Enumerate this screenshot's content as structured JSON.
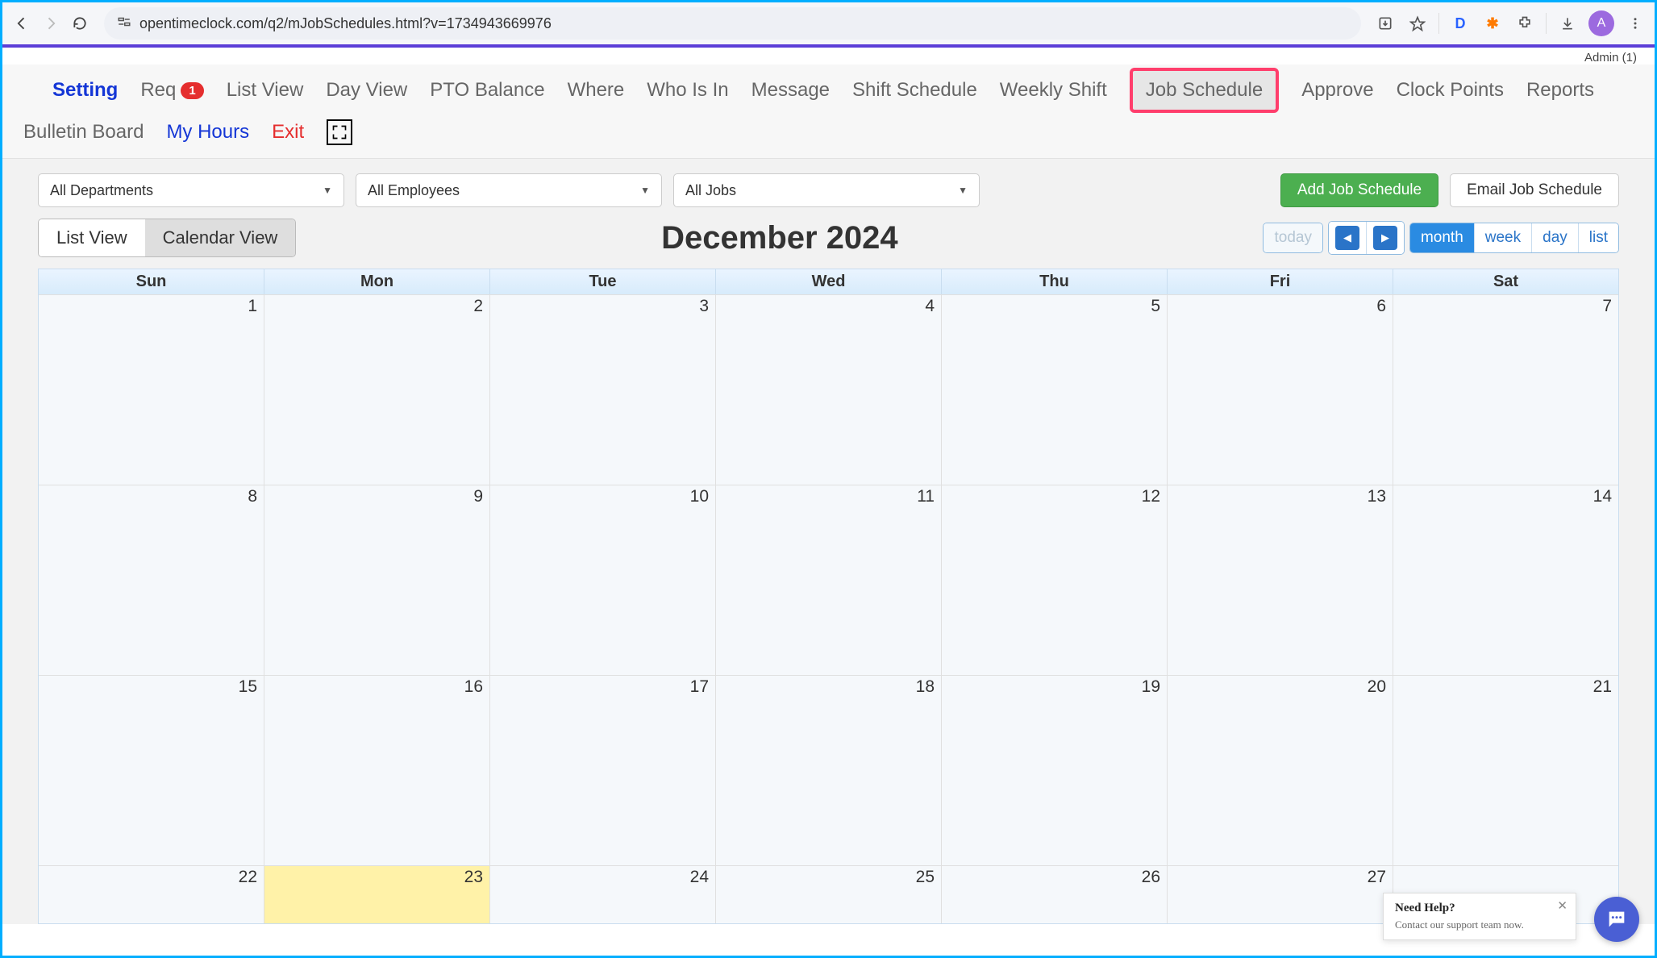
{
  "browser": {
    "url": "opentimeclock.com/q2/mJobSchedules.html?v=1734943669976",
    "avatar_letter": "A"
  },
  "top": {
    "admin_label": "Admin (1)"
  },
  "nav": {
    "setting": "Setting",
    "req": "Req",
    "req_badge": "1",
    "list_view": "List View",
    "day_view": "Day View",
    "pto": "PTO Balance",
    "where": "Where",
    "who": "Who Is In",
    "message": "Message",
    "shift": "Shift Schedule",
    "weekly": "Weekly Shift",
    "job_schedule": "Job Schedule",
    "approve": "Approve",
    "clock": "Clock Points",
    "reports": "Reports",
    "bulletin": "Bulletin Board",
    "my_hours": "My Hours",
    "exit": "Exit"
  },
  "filters": {
    "departments": "All Departments",
    "employees": "All Employees",
    "jobs": "All Jobs"
  },
  "buttons": {
    "add": "Add Job Schedule",
    "email": "Email Job Schedule"
  },
  "view_toggle": {
    "list": "List View",
    "calendar": "Calendar View"
  },
  "calendar": {
    "title": "December 2024",
    "today": "today",
    "month": "month",
    "week": "week",
    "day": "day",
    "list": "list",
    "days": [
      "Sun",
      "Mon",
      "Tue",
      "Wed",
      "Thu",
      "Fri",
      "Sat"
    ],
    "weeks": [
      [
        "1",
        "2",
        "3",
        "4",
        "5",
        "6",
        "7"
      ],
      [
        "8",
        "9",
        "10",
        "11",
        "12",
        "13",
        "14"
      ],
      [
        "15",
        "16",
        "17",
        "18",
        "19",
        "20",
        "21"
      ],
      [
        "22",
        "23",
        "24",
        "25",
        "26",
        "27",
        ""
      ]
    ],
    "today_cell": "23"
  },
  "help": {
    "title": "Need Help?",
    "sub": "Contact our support team now."
  }
}
